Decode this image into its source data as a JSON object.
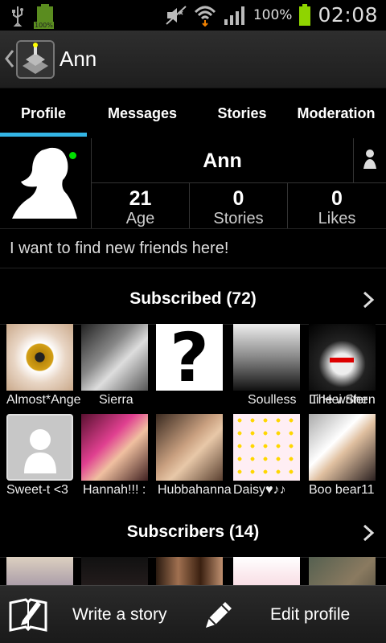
{
  "status_bar": {
    "battery_small": "100%",
    "battery_pct": "100%",
    "time": "02:08"
  },
  "action_bar": {
    "title": "Ann"
  },
  "tabs": [
    {
      "label": "Profile",
      "active": true
    },
    {
      "label": "Messages",
      "active": false
    },
    {
      "label": "Stories",
      "active": false
    },
    {
      "label": "Moderation",
      "active": false
    }
  ],
  "profile": {
    "name": "Ann",
    "stats": [
      {
        "value": "21",
        "label": "Age"
      },
      {
        "value": "0",
        "label": "Stories"
      },
      {
        "value": "0",
        "label": "Likes"
      }
    ],
    "status_text": "I want to find new friends here!"
  },
  "subscribed": {
    "title": "Subscribed (72)",
    "users": [
      {
        "name": "Almost*Angel",
        "thumb": "eye"
      },
      {
        "name": "Sierra",
        "thumb": "dog"
      },
      {
        "name": "The writer",
        "thumb": "question"
      },
      {
        "name": "Soulless",
        "thumb": "angel"
      },
      {
        "name": "Li Hei Shen",
        "thumb": "anime"
      },
      {
        "name": "Sweet-t <3",
        "thumb": "placeholder"
      },
      {
        "name": "Hannah!!! :",
        "thumb": "girl-pink"
      },
      {
        "name": "Hubbahanna",
        "thumb": "girl"
      },
      {
        "name": "Daisy♥♪♪",
        "thumb": "emoji"
      },
      {
        "name": "Boo bear11",
        "thumb": "selfie"
      }
    ]
  },
  "subscribers": {
    "title": "Subscribers (14)",
    "users": [
      {
        "thumb": "pug"
      },
      {
        "thumb": "dark"
      },
      {
        "thumb": "group"
      },
      {
        "thumb": "pink-hair"
      },
      {
        "thumb": "bear"
      }
    ]
  },
  "bottom_bar": {
    "write_story": "Write a story",
    "edit_profile": "Edit profile"
  },
  "colors": {
    "accent": "#33b5e5",
    "online": "#00e000"
  }
}
